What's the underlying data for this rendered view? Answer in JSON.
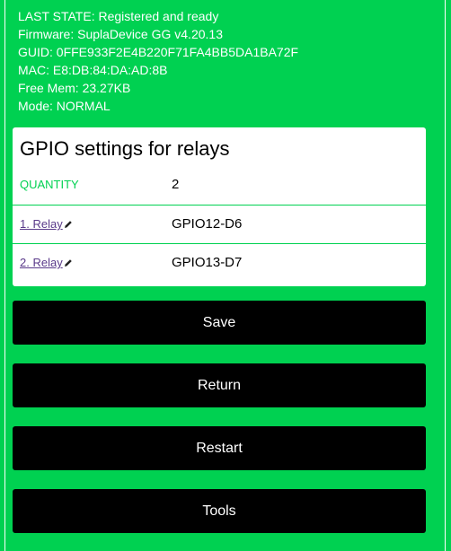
{
  "status": {
    "last_state": "LAST STATE: Registered and ready",
    "firmware": "Firmware: SuplaDevice GG v4.20.13",
    "guid": "GUID: 0FFE933F2E4B220F71FA4BB5DA1BA72F",
    "mac": "MAC: E8:DB:84:DA:AD:8B",
    "free_mem": "Free Mem: 23.27KB",
    "mode": "Mode: NORMAL"
  },
  "gpio_card": {
    "title": "GPIO settings for relays",
    "quantity_label": "QUANTITY",
    "quantity_value": "2",
    "relays": [
      {
        "label": "1. Relay",
        "gpio": "GPIO12-D6"
      },
      {
        "label": "2. Relay",
        "gpio": "GPIO13-D7"
      }
    ]
  },
  "buttons": {
    "save": "Save",
    "return": "Return",
    "restart": "Restart",
    "tools": "Tools"
  },
  "colors": {
    "background": "#00D151",
    "button": "#000000",
    "link": "#5a3a8a"
  },
  "icons": {
    "relay_edit": "pencil-icon"
  }
}
